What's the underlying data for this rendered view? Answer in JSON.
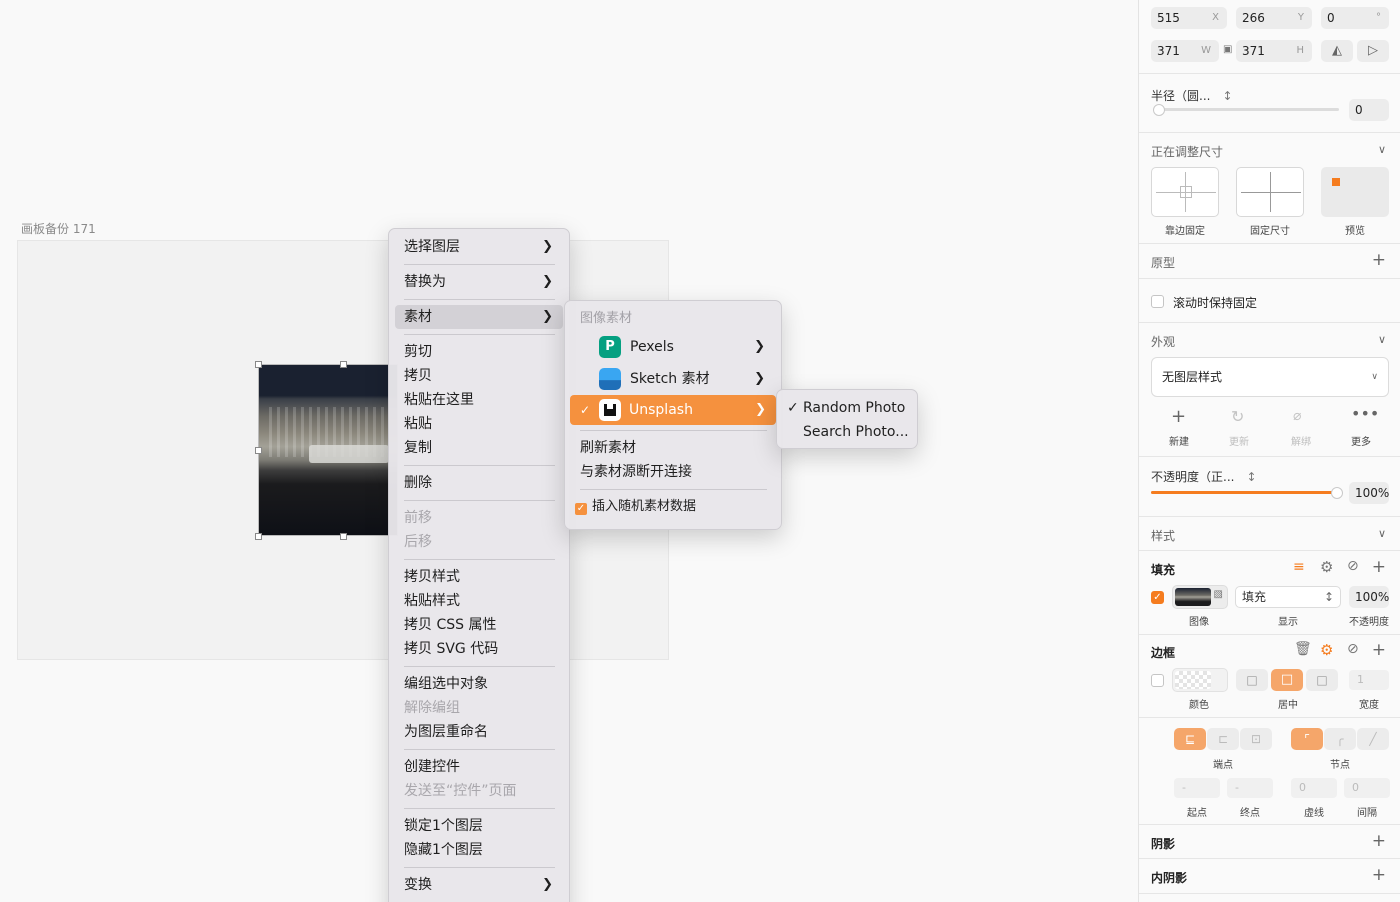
{
  "canvas": {
    "artboard_label": "画板备份 171"
  },
  "menu1": {
    "items": [
      {
        "label": "选择图层",
        "submenu": true
      },
      {
        "label": "替换为",
        "submenu": true
      },
      {
        "label": "素材",
        "submenu": true
      },
      {
        "label": "剪切"
      },
      {
        "label": "拷贝"
      },
      {
        "label": "粘贴在这里"
      },
      {
        "label": "粘贴"
      },
      {
        "label": "复制"
      },
      {
        "label": "删除"
      },
      {
        "label": "前移",
        "disabled": true
      },
      {
        "label": "后移",
        "disabled": true
      },
      {
        "label": "拷贝样式"
      },
      {
        "label": "粘贴样式"
      },
      {
        "label": "拷贝 CSS 属性"
      },
      {
        "label": "拷贝 SVG 代码"
      },
      {
        "label": "编组选中对象"
      },
      {
        "label": "解除编组",
        "disabled": true
      },
      {
        "label": "为图层重命名"
      },
      {
        "label": "创建控件"
      },
      {
        "label": "发送至“控件”页面",
        "disabled": true
      },
      {
        "label": "锁定1个图层"
      },
      {
        "label": "隐藏1个图层"
      },
      {
        "label": "变换",
        "submenu": true
      }
    ]
  },
  "menu2": {
    "header": "图像素材",
    "sources": [
      {
        "label": "Pexels",
        "icon": "pexels-icon",
        "color": "#05a081"
      },
      {
        "label": "Sketch 素材",
        "icon": "sketch-data-icon",
        "color": "#1e88d8"
      },
      {
        "label": "Unsplash",
        "icon": "unsplash-icon",
        "color": "#111111",
        "checked": true
      }
    ],
    "refresh": "刷新素材",
    "disconnect": "与素材源断开连接",
    "insert_random": "插入随机素材数据"
  },
  "menu3": {
    "random": "Random Photo",
    "search": "Search Photo..."
  },
  "inspector": {
    "x": "515",
    "x_suffix": "X",
    "y": "266",
    "y_suffix": "Y",
    "rotation": "0",
    "rotation_suffix": "°",
    "w": "371",
    "w_suffix": "W",
    "h": "371",
    "h_suffix": "H",
    "radius_label": "半径（圆...",
    "radius_value": "0",
    "resizing_title": "正在调整尺寸",
    "resize_options": [
      "靠边固定",
      "固定尺寸",
      "预览"
    ],
    "prototype_title": "原型",
    "keep_fixed_label": "滚动时保持固定",
    "appearance_title": "外观",
    "layer_style": "无图层样式",
    "style_actions": [
      {
        "label": "新建",
        "disabled": false
      },
      {
        "label": "更新",
        "disabled": true
      },
      {
        "label": "解绑",
        "disabled": true
      },
      {
        "label": "更多",
        "disabled": false
      }
    ],
    "opacity_label": "不透明度（正...",
    "opacity_value": "100%",
    "opacity_level": 1.0,
    "style_title": "样式",
    "fill_title": "填充",
    "fill_mode": "填充",
    "fill_opacity": "100%",
    "fill_labels": [
      "图像",
      "显示",
      "不透明度"
    ],
    "border_title": "边框",
    "border_width": "1",
    "border_labels": [
      "颜色",
      "居中",
      "宽度"
    ],
    "endpoint_label": "端点",
    "joint_label": "节点",
    "start_value": "-",
    "end_value": "-",
    "dash_value": "0",
    "gap_value": "0",
    "line_labels": [
      "起点",
      "终点",
      "虚线",
      "间隔"
    ],
    "shadow_title": "阴影",
    "inner_shadow_title": "内阴影",
    "accent_color": "#f57c1f"
  }
}
